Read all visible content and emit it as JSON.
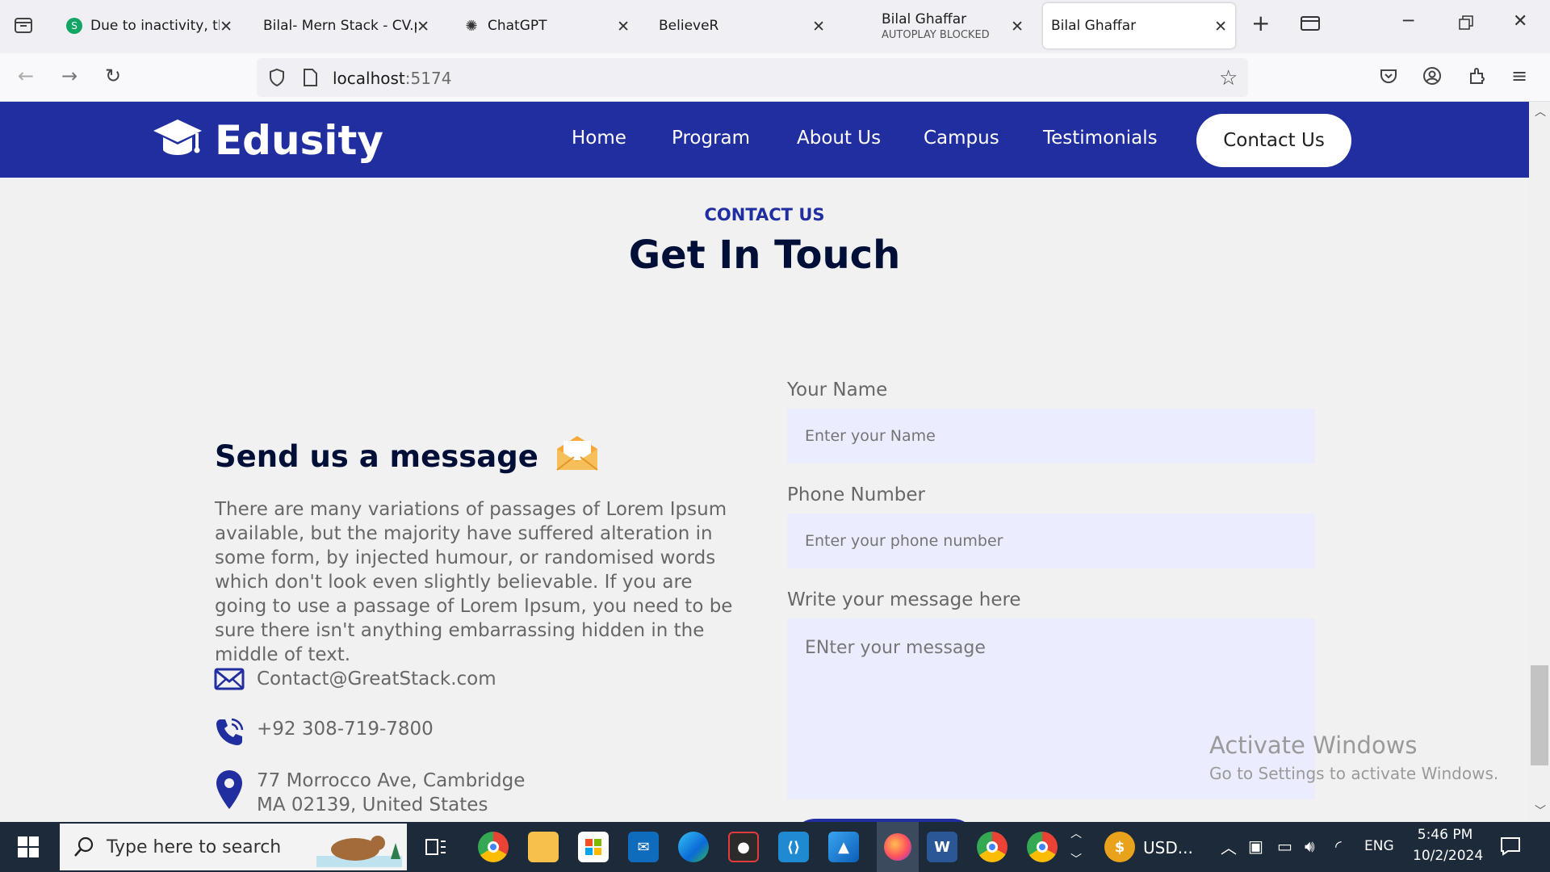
{
  "browser": {
    "tabs": [
      {
        "title": "Due to inactivity, the",
        "subtitle": ""
      },
      {
        "title": "Bilal- Mern Stack - CV.p",
        "subtitle": ""
      },
      {
        "title": "ChatGPT",
        "subtitle": ""
      },
      {
        "title": "BelieveR",
        "subtitle": ""
      },
      {
        "title": "Bilal Ghaffar",
        "subtitle": "AUTOPLAY BLOCKED"
      },
      {
        "title": "Bilal Ghaffar",
        "subtitle": ""
      }
    ],
    "url_host": "localhost",
    "url_port": ":5174"
  },
  "site": {
    "brand": "Edusity",
    "nav": [
      "Home",
      "Program",
      "About Us",
      "Campus",
      "Testimonials"
    ],
    "cta": "Contact Us"
  },
  "section": {
    "eyebrow": "CONTACT US",
    "headline": "Get In Touch"
  },
  "contact": {
    "title": "Send us a message",
    "paragraph": "There are many variations of passages of Lorem Ipsum available, but the majority have suffered alteration in some form, by injected humour, or randomised words which don't look even slightly believable. If you are going to use a passage of Lorem Ipsum, you need to be sure there isn't anything embarrassing hidden in the middle of text.",
    "email": "Contact@GreatStack.com",
    "phone": "+92 308-719-7800",
    "address_line1": "77 Morrocco Ave, Cambridge",
    "address_line2": "MA 02139, United States"
  },
  "form": {
    "name_label": "Your Name",
    "name_placeholder": "Enter your Name",
    "phone_label": "Phone Number",
    "phone_placeholder": "Enter your phone number",
    "message_label": "Write your message here",
    "message_placeholder": "ENter your message"
  },
  "watermark": {
    "line1": "Activate Windows",
    "line2": "Go to Settings to activate Windows."
  },
  "taskbar": {
    "search_placeholder": "Type here to search",
    "widget_text": "USD...",
    "language": "ENG",
    "time": "5:46 PM",
    "date": "10/2/2024"
  },
  "colors": {
    "brand": "#212ea0",
    "heading": "#000f38",
    "field_bg": "#ebecfe"
  }
}
